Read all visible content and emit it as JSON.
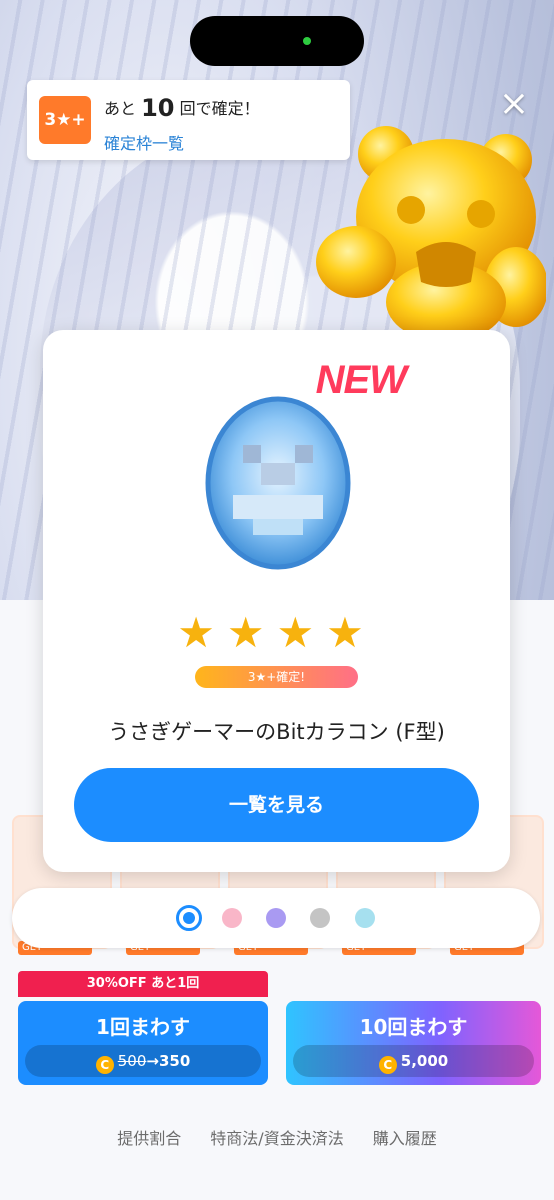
{
  "banner": {
    "badge": "3★+",
    "prefix": "あと",
    "count": "10",
    "suffix": "回で確定！",
    "link": "確定枠一覧"
  },
  "close_icon": "×",
  "modal": {
    "new_tag": "NEW",
    "stars": "★★★★",
    "guarantee_badge": "3★+確定!",
    "item_name": "うさぎゲーマーのBitカラコン (F型)",
    "view_button": "一覧を見る"
  },
  "pager": {
    "colors": [
      "#1c8dff",
      "#f9b6c8",
      "#a99af2",
      "#c4c4c4",
      "#a6e0ef"
    ]
  },
  "bottom": {
    "discount_label": "30%OFF あと1回",
    "spin1": {
      "label": "1回まわす",
      "old_price": "500",
      "arrow": "→",
      "new_price": "350"
    },
    "spin10": {
      "label": "10回まわす",
      "price": "5,000"
    },
    "coin_symbol": "C"
  },
  "footer": {
    "links": [
      "提供割合",
      "特商法/資金決済法",
      "購入履歴"
    ]
  },
  "background": {
    "tile_badge": "GET"
  }
}
